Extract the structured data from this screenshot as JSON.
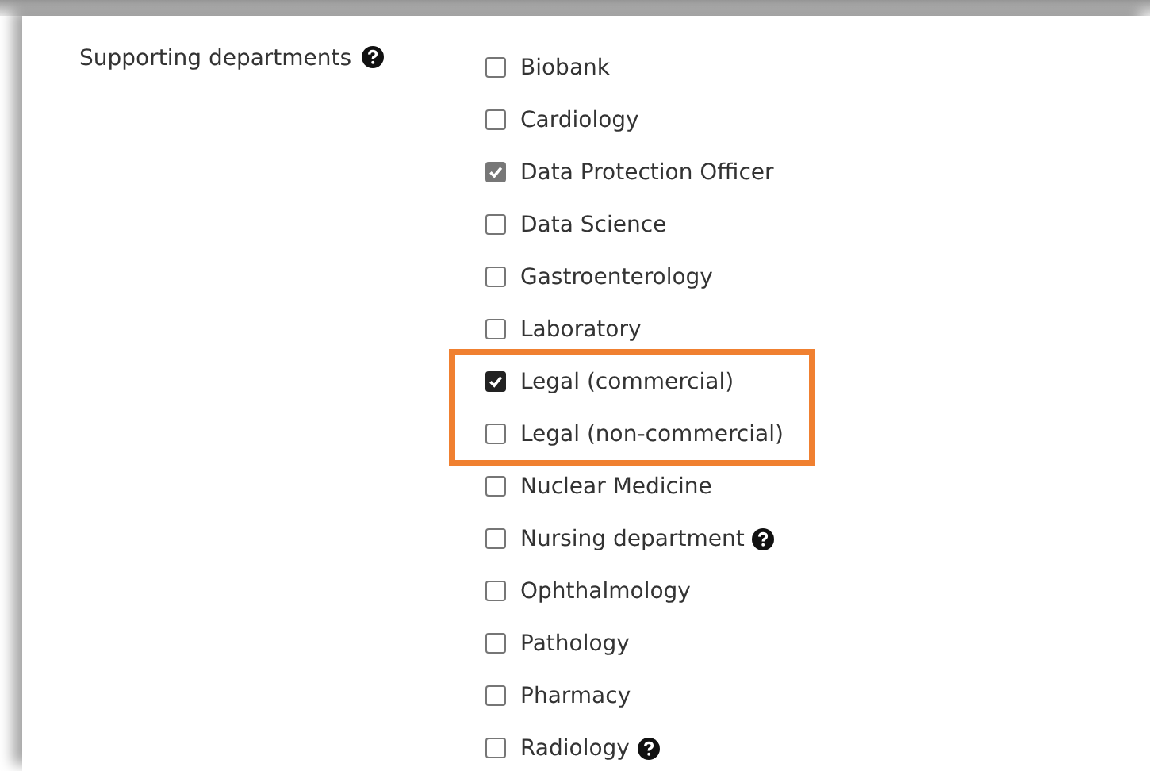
{
  "field": {
    "label": "Supporting departments",
    "kind": "with-help"
  },
  "option_groups": [
    {
      "highlighted": false,
      "options": [
        {
          "label": "Biobank",
          "kind": "plain",
          "checked": false,
          "disabled": false
        },
        {
          "label": "Cardiology",
          "kind": "plain",
          "checked": false,
          "disabled": false
        },
        {
          "label": "Data Protection Officer",
          "kind": "plain",
          "checked": true,
          "disabled": true
        },
        {
          "label": "Data Science",
          "kind": "plain",
          "checked": false,
          "disabled": false
        },
        {
          "label": "Gastroenterology",
          "kind": "plain",
          "checked": false,
          "disabled": false
        },
        {
          "label": "Laboratory",
          "kind": "plain",
          "checked": false,
          "disabled": false
        }
      ]
    },
    {
      "highlighted": true,
      "options": [
        {
          "label": "Legal (commercial)",
          "kind": "plain",
          "checked": true,
          "disabled": false
        },
        {
          "label": "Legal (non-commercial)",
          "kind": "plain",
          "checked": false,
          "disabled": false
        }
      ]
    },
    {
      "highlighted": false,
      "options": [
        {
          "label": "Nuclear Medicine",
          "kind": "plain",
          "checked": false,
          "disabled": false
        },
        {
          "label": "Nursing department",
          "kind": "with-help",
          "checked": false,
          "disabled": false
        },
        {
          "label": "Ophthalmology",
          "kind": "plain",
          "checked": false,
          "disabled": false
        },
        {
          "label": "Pathology",
          "kind": "plain",
          "checked": false,
          "disabled": false
        },
        {
          "label": "Pharmacy",
          "kind": "plain",
          "checked": false,
          "disabled": false
        },
        {
          "label": "Radiology",
          "kind": "with-help",
          "checked": false,
          "disabled": false
        }
      ]
    }
  ]
}
